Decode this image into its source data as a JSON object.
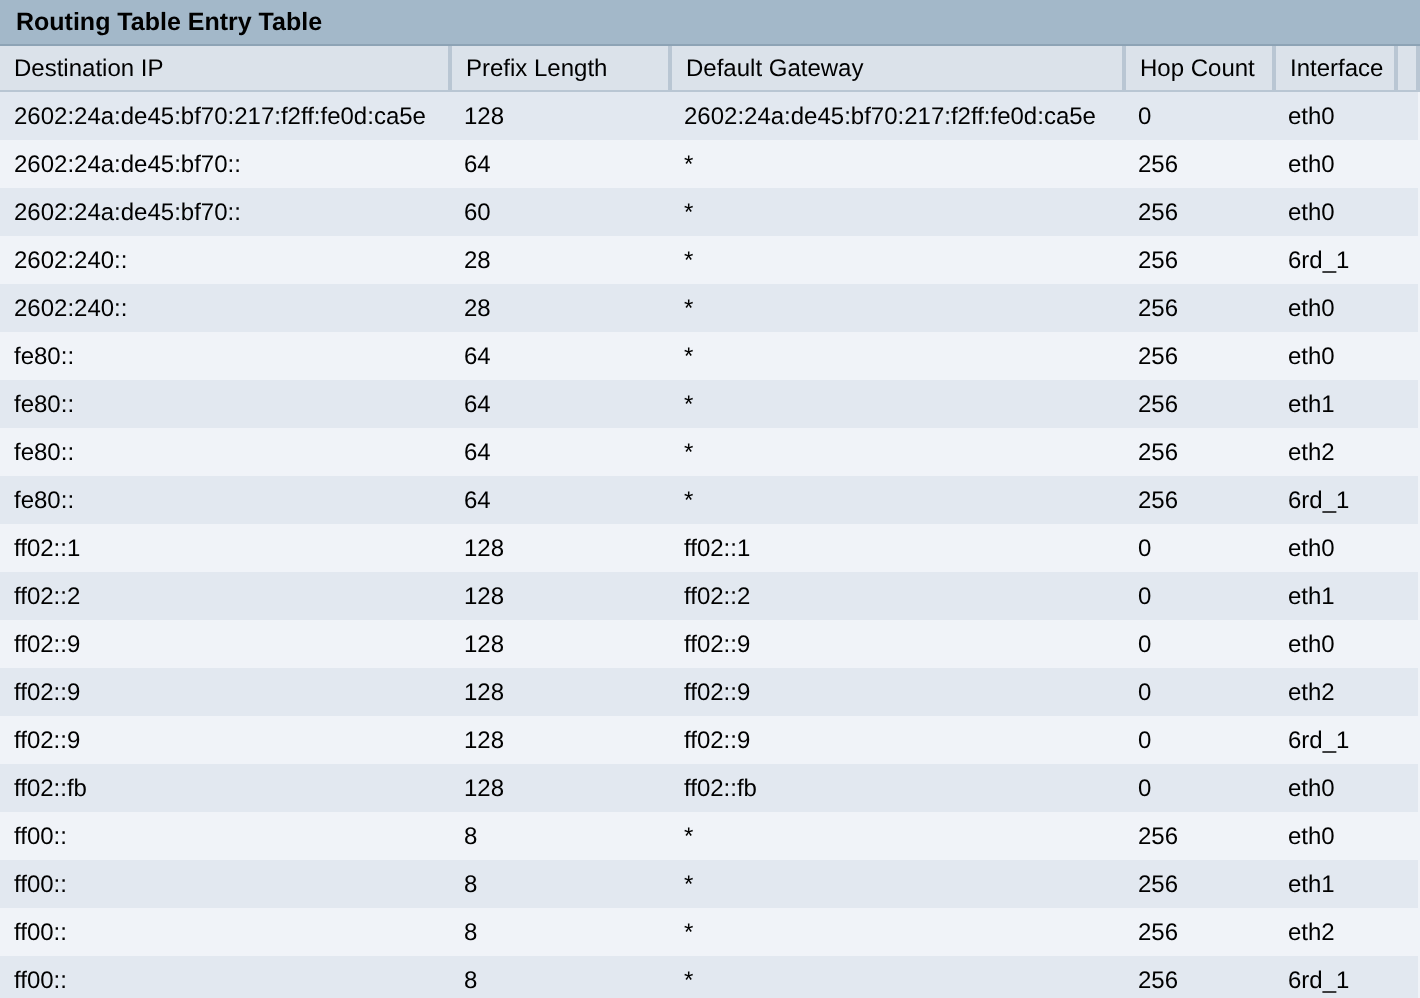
{
  "title": "Routing Table Entry Table",
  "table": {
    "columns": [
      "Destination IP",
      "Prefix Length",
      "Default Gateway",
      "Hop Count",
      "Interface"
    ],
    "rows": [
      [
        "2602:24a:de45:bf70:217:f2ff:fe0d:ca5e",
        "128",
        "2602:24a:de45:bf70:217:f2ff:fe0d:ca5e",
        "0",
        "eth0"
      ],
      [
        "2602:24a:de45:bf70::",
        "64",
        "*",
        "256",
        "eth0"
      ],
      [
        "2602:24a:de45:bf70::",
        "60",
        "*",
        "256",
        "eth0"
      ],
      [
        "2602:240::",
        "28",
        "*",
        "256",
        "6rd_1"
      ],
      [
        "2602:240::",
        "28",
        "*",
        "256",
        "eth0"
      ],
      [
        "fe80::",
        "64",
        "*",
        "256",
        "eth0"
      ],
      [
        "fe80::",
        "64",
        "*",
        "256",
        "eth1"
      ],
      [
        "fe80::",
        "64",
        "*",
        "256",
        "eth2"
      ],
      [
        "fe80::",
        "64",
        "*",
        "256",
        "6rd_1"
      ],
      [
        "ff02::1",
        "128",
        "ff02::1",
        "0",
        "eth0"
      ],
      [
        "ff02::2",
        "128",
        "ff02::2",
        "0",
        "eth1"
      ],
      [
        "ff02::9",
        "128",
        "ff02::9",
        "0",
        "eth0"
      ],
      [
        "ff02::9",
        "128",
        "ff02::9",
        "0",
        "eth2"
      ],
      [
        "ff02::9",
        "128",
        "ff02::9",
        "0",
        "6rd_1"
      ],
      [
        "ff02::fb",
        "128",
        "ff02::fb",
        "0",
        "eth0"
      ],
      [
        "ff00::",
        "8",
        "*",
        "256",
        "eth0"
      ],
      [
        "ff00::",
        "8",
        "*",
        "256",
        "eth1"
      ],
      [
        "ff00::",
        "8",
        "*",
        "256",
        "eth2"
      ],
      [
        "ff00::",
        "8",
        "*",
        "256",
        "6rd_1"
      ]
    ]
  }
}
